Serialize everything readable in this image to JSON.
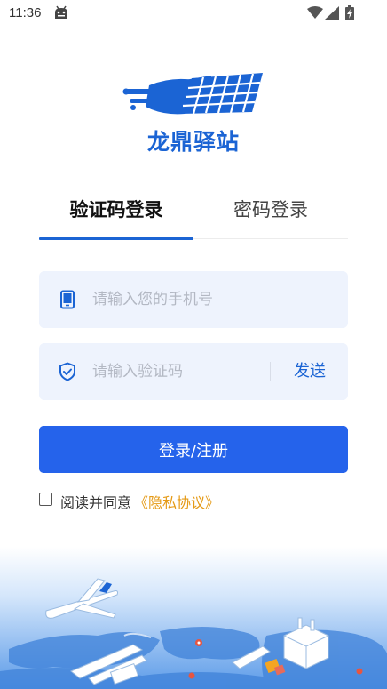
{
  "status_bar": {
    "time": "11:36",
    "icons": [
      "android-debug-icon",
      "wifi-icon",
      "cell-signal-icon",
      "battery-charging-icon"
    ]
  },
  "brand": {
    "name": "龙鼎驿站",
    "color": "#1b64d4"
  },
  "tabs": [
    {
      "label": "验证码登录",
      "active": true
    },
    {
      "label": "密码登录",
      "active": false
    }
  ],
  "phone_field": {
    "placeholder": "请输入您的手机号",
    "value": "",
    "icon": "phone-icon"
  },
  "code_field": {
    "placeholder": "请输入验证码",
    "value": "",
    "icon": "shield-check-icon",
    "send_label": "发送"
  },
  "login_button": {
    "label": "登录/注册",
    "color": "#2563eb"
  },
  "agreement": {
    "checked": false,
    "text": "阅读并同意",
    "link_text": "《隐私协议》",
    "link_color": "#e59a16"
  }
}
